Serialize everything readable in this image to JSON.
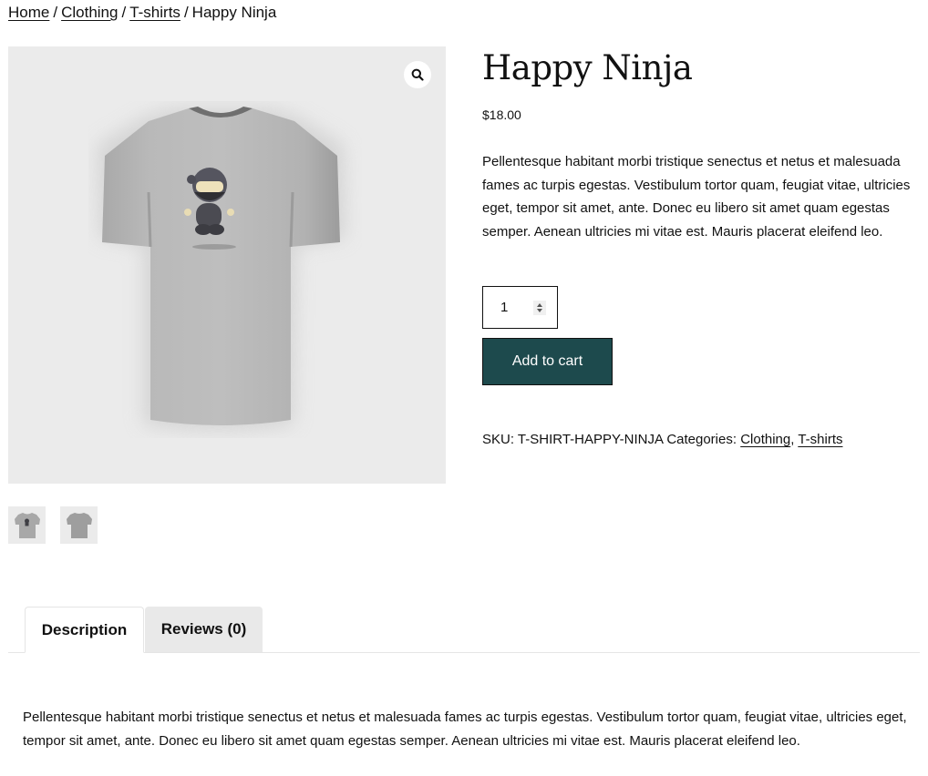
{
  "breadcrumb": {
    "items": [
      {
        "label": "Home",
        "link": true
      },
      {
        "label": "Clothing",
        "link": true
      },
      {
        "label": "T-shirts",
        "link": true
      },
      {
        "label": "Happy Ninja",
        "link": false
      }
    ],
    "separator": "/"
  },
  "gallery": {
    "main_image_alt": "Happy Ninja t-shirt",
    "zoom_icon": "magnifier-icon",
    "thumbnails": [
      {
        "alt": "Happy Ninja t-shirt front"
      },
      {
        "alt": "Happy Ninja t-shirt back"
      }
    ]
  },
  "product": {
    "title": "Happy Ninja",
    "price": "$18.00",
    "short_description": "Pellentesque habitant morbi tristique senectus et netus et malesuada fames ac turpis egestas. Vestibulum tortor quam, feugiat vitae, ultricies eget, tempor sit amet, ante. Donec eu libero sit amet quam egestas semper. Aenean ultricies mi vitae est. Mauris placerat eleifend leo.",
    "quantity": "1",
    "add_to_cart_label": "Add to cart",
    "sku_label": "SKU:",
    "sku": "T-SHIRT-HAPPY-NINJA",
    "categories_label": "Categories:",
    "categories": [
      "Clothing",
      "T-shirts"
    ],
    "category_separator": ","
  },
  "tabs": [
    {
      "label": "Description",
      "active": true
    },
    {
      "label": "Reviews (0)",
      "active": false
    }
  ],
  "description": "Pellentesque habitant morbi tristique senectus et netus et malesuada fames ac turpis egestas. Vestibulum tortor quam, feugiat vitae, ultricies eget, tempor sit amet, ante. Donec eu libero sit amet quam egestas semper. Aenean ultricies mi vitae est. Mauris placerat eleifend leo.",
  "colors": {
    "button_bg": "#1d4a4d",
    "gallery_bg": "#ebebeb",
    "inactive_tab_bg": "#e9e9e9"
  }
}
